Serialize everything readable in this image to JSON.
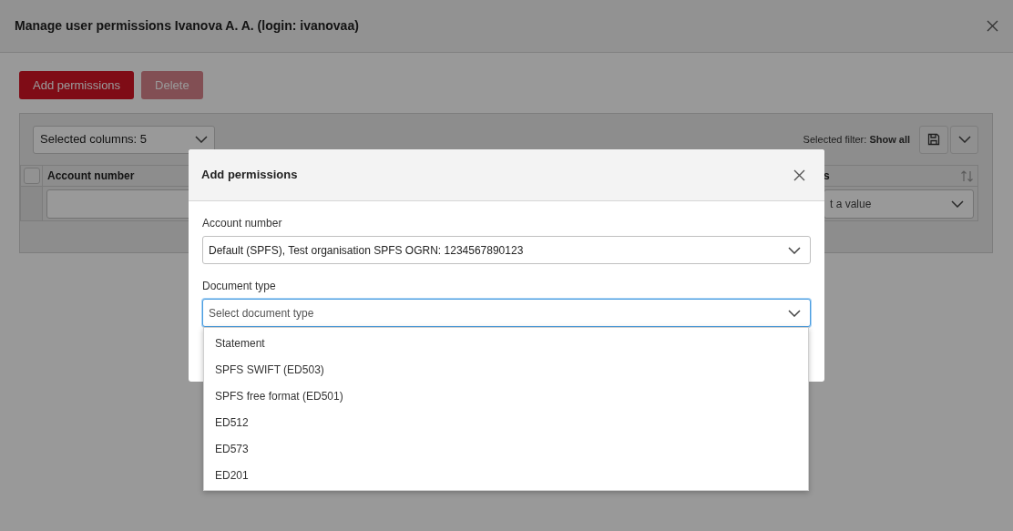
{
  "dialog": {
    "title": "Manage user permissions Ivanova A. A. (login: ivanovaa)"
  },
  "toolbar": {
    "buttons": [
      {
        "label": "Add permissions",
        "disabled": false
      },
      {
        "label": "Delete",
        "disabled": true
      }
    ]
  },
  "grid": {
    "columns_select": "Selected columns: 5",
    "filter_label": "Selected filter:",
    "filter_value": "Show all",
    "header_checkbox": {
      "checked": false
    },
    "columns": [
      {
        "header": "Account number",
        "filter": {
          "kind": "input"
        }
      },
      {
        "header": "s",
        "sortable": true,
        "filter": {
          "kind": "select",
          "placeholder": "t a value"
        }
      }
    ]
  },
  "modal": {
    "title": "Add permissions",
    "fields": [
      {
        "label": "Account number",
        "value": "Default (SPFS), Test organisation SPFS OGRN: 1234567890123",
        "focused": false
      },
      {
        "label": "Document type",
        "placeholder": "Select document type",
        "focused": true,
        "expanded": true,
        "options": [
          {
            "label": "Statement",
            "selected": false
          },
          {
            "label": "SPFS SWIFT (ED503)",
            "selected": false
          },
          {
            "label": "SPFS free format (ED501)",
            "selected": false
          },
          {
            "label": "ED512",
            "selected": false
          },
          {
            "label": "ED573",
            "selected": false
          },
          {
            "label": "ED201",
            "selected": false
          }
        ]
      }
    ]
  }
}
